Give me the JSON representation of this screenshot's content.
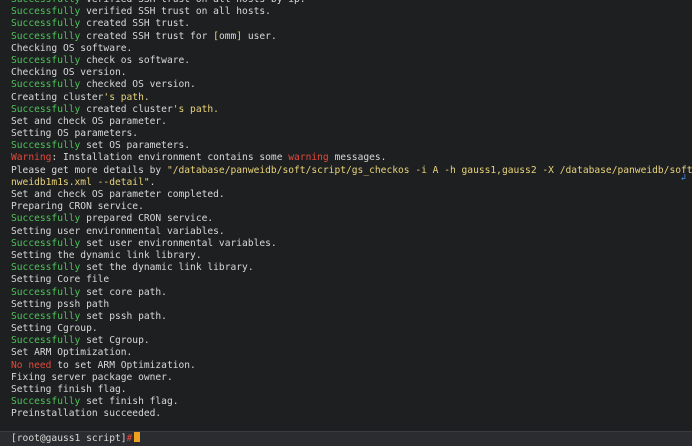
{
  "lines": [
    [
      {
        "t": "Successfully",
        "c": "ok"
      },
      {
        "t": " verified SSH trust on all hosts by ip."
      }
    ],
    [
      {
        "t": "Successfully",
        "c": "ok"
      },
      {
        "t": " verified SSH trust on all hosts."
      }
    ],
    [
      {
        "t": "Successfully",
        "c": "ok"
      },
      {
        "t": " created SSH trust."
      }
    ],
    [
      {
        "t": "Successfully",
        "c": "ok"
      },
      {
        "t": " created SSH trust for "
      },
      {
        "t": "[",
        "c": "hl"
      },
      {
        "t": "omm"
      },
      {
        "t": "]",
        "c": "hl"
      },
      {
        "t": " user."
      }
    ],
    [
      {
        "t": "Checking OS software."
      }
    ],
    [
      {
        "t": "Successfully",
        "c": "ok"
      },
      {
        "t": " check os software."
      }
    ],
    [
      {
        "t": "Checking OS version."
      }
    ],
    [
      {
        "t": "Successfully",
        "c": "ok"
      },
      {
        "t": " checked OS version."
      }
    ],
    [
      {
        "t": "Creating cluster"
      },
      {
        "t": "'s path.",
        "c": "hl"
      }
    ],
    [
      {
        "t": "Successfully",
        "c": "ok"
      },
      {
        "t": " created cluster"
      },
      {
        "t": "'s path.",
        "c": "hl"
      }
    ],
    [
      {
        "t": "Set and check OS parameter."
      }
    ],
    [
      {
        "t": "Setting OS parameters."
      }
    ],
    [
      {
        "t": "Successfully",
        "c": "ok"
      },
      {
        "t": " set OS parameters."
      }
    ],
    [
      {
        "t": "Warning",
        "c": "warn"
      },
      {
        "t": ": Installation environment contains some "
      },
      {
        "t": "warning",
        "c": "warn"
      },
      {
        "t": " messages."
      }
    ],
    [
      {
        "t": "Please get more details by "
      },
      {
        "t": "\"/database/panweidb/soft/script/gs_checkos -i A -h gauss1,gauss2 -X /database/panweidb/soft/pa",
        "c": "path"
      }
    ],
    [
      {
        "t": "nweidb1m1s.xml --detail\"",
        "c": "path"
      },
      {
        "t": "."
      }
    ],
    [
      {
        "t": "Set and check OS parameter completed."
      }
    ],
    [
      {
        "t": "Preparing CRON service."
      }
    ],
    [
      {
        "t": "Successfully",
        "c": "ok"
      },
      {
        "t": " prepared CRON service."
      }
    ],
    [
      {
        "t": "Setting user environmental variables."
      }
    ],
    [
      {
        "t": "Successfully",
        "c": "ok"
      },
      {
        "t": " set user environmental variables."
      }
    ],
    [
      {
        "t": "Setting the dynamic link library."
      }
    ],
    [
      {
        "t": "Successfully",
        "c": "ok"
      },
      {
        "t": " set the dynamic link library."
      }
    ],
    [
      {
        "t": "Setting Core file"
      }
    ],
    [
      {
        "t": "Successfully",
        "c": "ok"
      },
      {
        "t": " set core path."
      }
    ],
    [
      {
        "t": "Setting pssh path"
      }
    ],
    [
      {
        "t": "Successfully",
        "c": "ok"
      },
      {
        "t": " set pssh path."
      }
    ],
    [
      {
        "t": "Setting Cgroup."
      }
    ],
    [
      {
        "t": "Successfully",
        "c": "ok"
      },
      {
        "t": " set Cgroup."
      }
    ],
    [
      {
        "t": "Set ARM Optimization."
      }
    ],
    [
      {
        "t": "No need",
        "c": "warn"
      },
      {
        "t": " to set ARM Optimization."
      }
    ],
    [
      {
        "t": "Fixing server package owner."
      }
    ],
    [
      {
        "t": "Setting finish flag."
      }
    ],
    [
      {
        "t": "Successfully",
        "c": "ok"
      },
      {
        "t": " set finish flag."
      }
    ],
    [
      {
        "t": "Preinstallation succeeded."
      }
    ]
  ],
  "prompt": {
    "text": "[root@gauss1 script]",
    "symbol": "#"
  },
  "colors": {
    "background": "#1e1f21",
    "success": "#4fc35a",
    "warning": "#e04a3d",
    "highlight": "#e8d37a",
    "cursor": "#f0a020"
  },
  "icons": {
    "wrap": "line-wrap-icon"
  }
}
